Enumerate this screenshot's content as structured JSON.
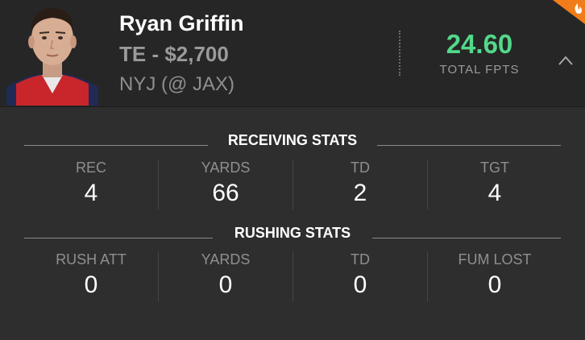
{
  "player": {
    "name": "Ryan Griffin",
    "position_salary": "TE - $2,700",
    "matchup": "NYJ (@ JAX)",
    "fpts_value": "24.60",
    "fpts_label": "TOTAL FPTS"
  },
  "receiving": {
    "title": "RECEIVING STATS",
    "stats": [
      {
        "label": "REC",
        "value": "4"
      },
      {
        "label": "YARDS",
        "value": "66"
      },
      {
        "label": "TD",
        "value": "2"
      },
      {
        "label": "TGT",
        "value": "4"
      }
    ]
  },
  "rushing": {
    "title": "RUSHING STATS",
    "stats": [
      {
        "label": "RUSH ATT",
        "value": "0"
      },
      {
        "label": "YARDS",
        "value": "0"
      },
      {
        "label": "TD",
        "value": "0"
      },
      {
        "label": "FUM LOST",
        "value": "0"
      }
    ]
  },
  "icons": {
    "collapse": "chevron-up-icon",
    "hot": "flame-icon"
  },
  "colors": {
    "fpts": "#52d88a",
    "badge": "#f07d1a",
    "background": "#2e2e2e"
  }
}
